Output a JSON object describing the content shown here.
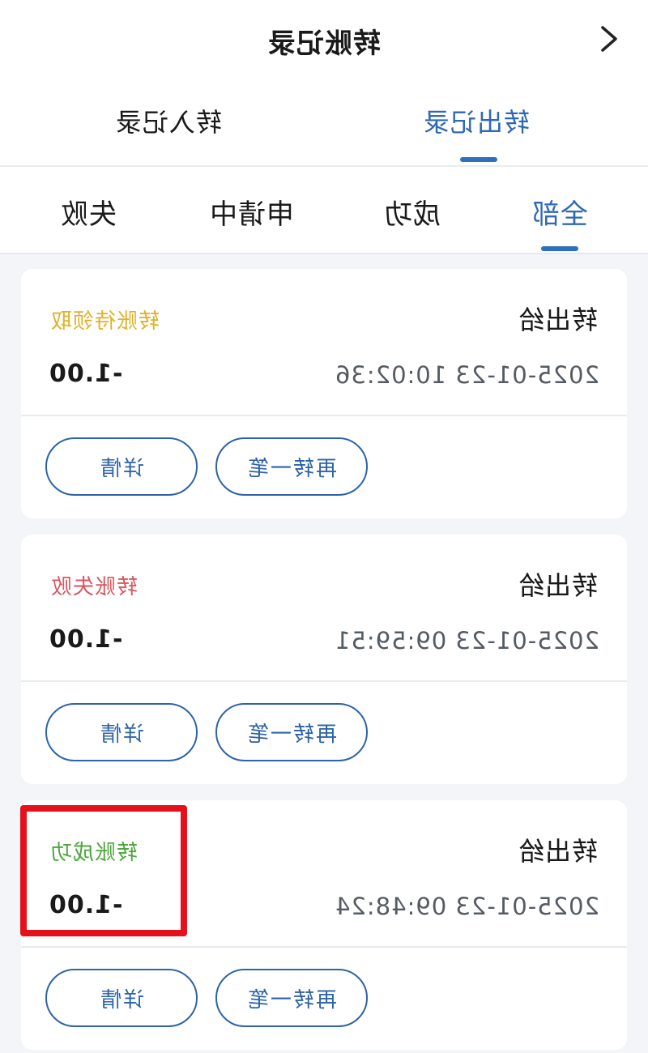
{
  "header": {
    "title": "转账记录",
    "nav_icon": "chevron-icon"
  },
  "main_tabs": [
    {
      "label": "转入记录",
      "active": false
    },
    {
      "label": "转出记录",
      "active": true
    }
  ],
  "filter_tabs": [
    {
      "label": "全部",
      "active": true
    },
    {
      "label": "成功",
      "active": false
    },
    {
      "label": "申请中",
      "active": false
    },
    {
      "label": "失败",
      "active": false
    }
  ],
  "records": [
    {
      "recipient": "转出给",
      "status": "转账待领取",
      "status_color": "#e0b12a",
      "time": "2025-01-23 10:02:36",
      "amount": "-1.00",
      "btn_again": "再转一笔",
      "btn_detail": "详情"
    },
    {
      "recipient": "转出给",
      "status": "转账失败",
      "status_color": "#d9565e",
      "time": "2025-01-23 09:59:51",
      "amount": "-1.00",
      "btn_again": "再转一笔",
      "btn_detail": "详情"
    },
    {
      "recipient": "转出给",
      "status": "转账成功",
      "status_color": "#4ca63c",
      "time": "2025-01-23 09:48:24",
      "amount": "-1.00",
      "btn_again": "再转一笔",
      "btn_detail": "详情"
    }
  ],
  "colors": {
    "accent": "#2f68b4",
    "highlight": "#e4101c",
    "background": "#f3f5f9"
  }
}
